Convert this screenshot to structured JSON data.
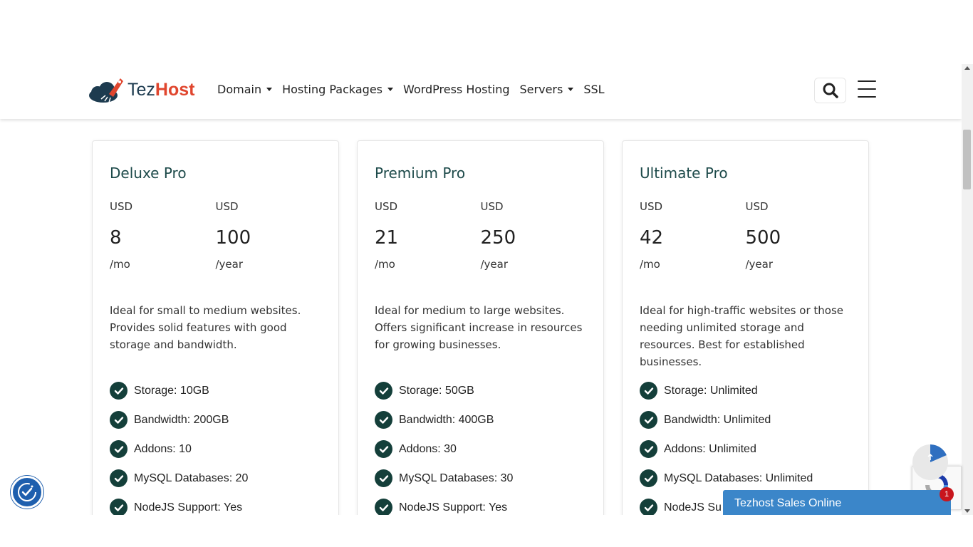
{
  "navbar": {
    "logo": {
      "part1": "Tez",
      "part2": "Host"
    },
    "menu": [
      {
        "label": "Domain",
        "has_dropdown": true
      },
      {
        "label": "Hosting Packages",
        "has_dropdown": true
      },
      {
        "label": "WordPress Hosting",
        "has_dropdown": false
      },
      {
        "label": "Servers",
        "has_dropdown": true
      },
      {
        "label": "SSL",
        "has_dropdown": false
      }
    ],
    "search_icon": "search-icon",
    "menu_icon": "hamburger-icon"
  },
  "plans": [
    {
      "title": "Deluxe Pro",
      "monthly": {
        "currency": "USD",
        "amount": "8",
        "period": "/mo"
      },
      "yearly": {
        "currency": "USD",
        "amount": "100",
        "period": "/year"
      },
      "description": "Ideal for small to medium websites. Provides solid features with good storage and bandwidth.",
      "features": [
        "Storage: 10GB",
        "Bandwidth: 200GB",
        "Addons: 10",
        "MySQL Databases: 20",
        "NodeJS Support: Yes"
      ]
    },
    {
      "title": "Premium Pro",
      "monthly": {
        "currency": "USD",
        "amount": "21",
        "period": "/mo"
      },
      "yearly": {
        "currency": "USD",
        "amount": "250",
        "period": "/year"
      },
      "description": "Ideal for medium to large websites. Offers significant increase in resources for growing businesses.",
      "features": [
        "Storage: 50GB",
        "Bandwidth: 400GB",
        "Addons: 30",
        "MySQL Databases: 30",
        "NodeJS Support: Yes"
      ]
    },
    {
      "title": "Ultimate Pro",
      "monthly": {
        "currency": "USD",
        "amount": "42",
        "period": "/mo"
      },
      "yearly": {
        "currency": "USD",
        "amount": "500",
        "period": "/year"
      },
      "description": "Ideal for high-traffic websites or those needing unlimited storage and resources. Best for established businesses.",
      "features": [
        "Storage: Unlimited",
        "Bandwidth: Unlimited",
        "Addons: Unlimited",
        "MySQL Databases: Unlimited",
        "NodeJS Su"
      ]
    }
  ],
  "chat": {
    "label": "Tezhost Sales Online",
    "count": "1"
  },
  "colors": {
    "brand_dark": "#1d3b4f",
    "brand_red": "#e0462e",
    "check_green": "#143f3a",
    "chat_blue": "#3b86c9",
    "accessibility_blue": "#1e5fae"
  }
}
